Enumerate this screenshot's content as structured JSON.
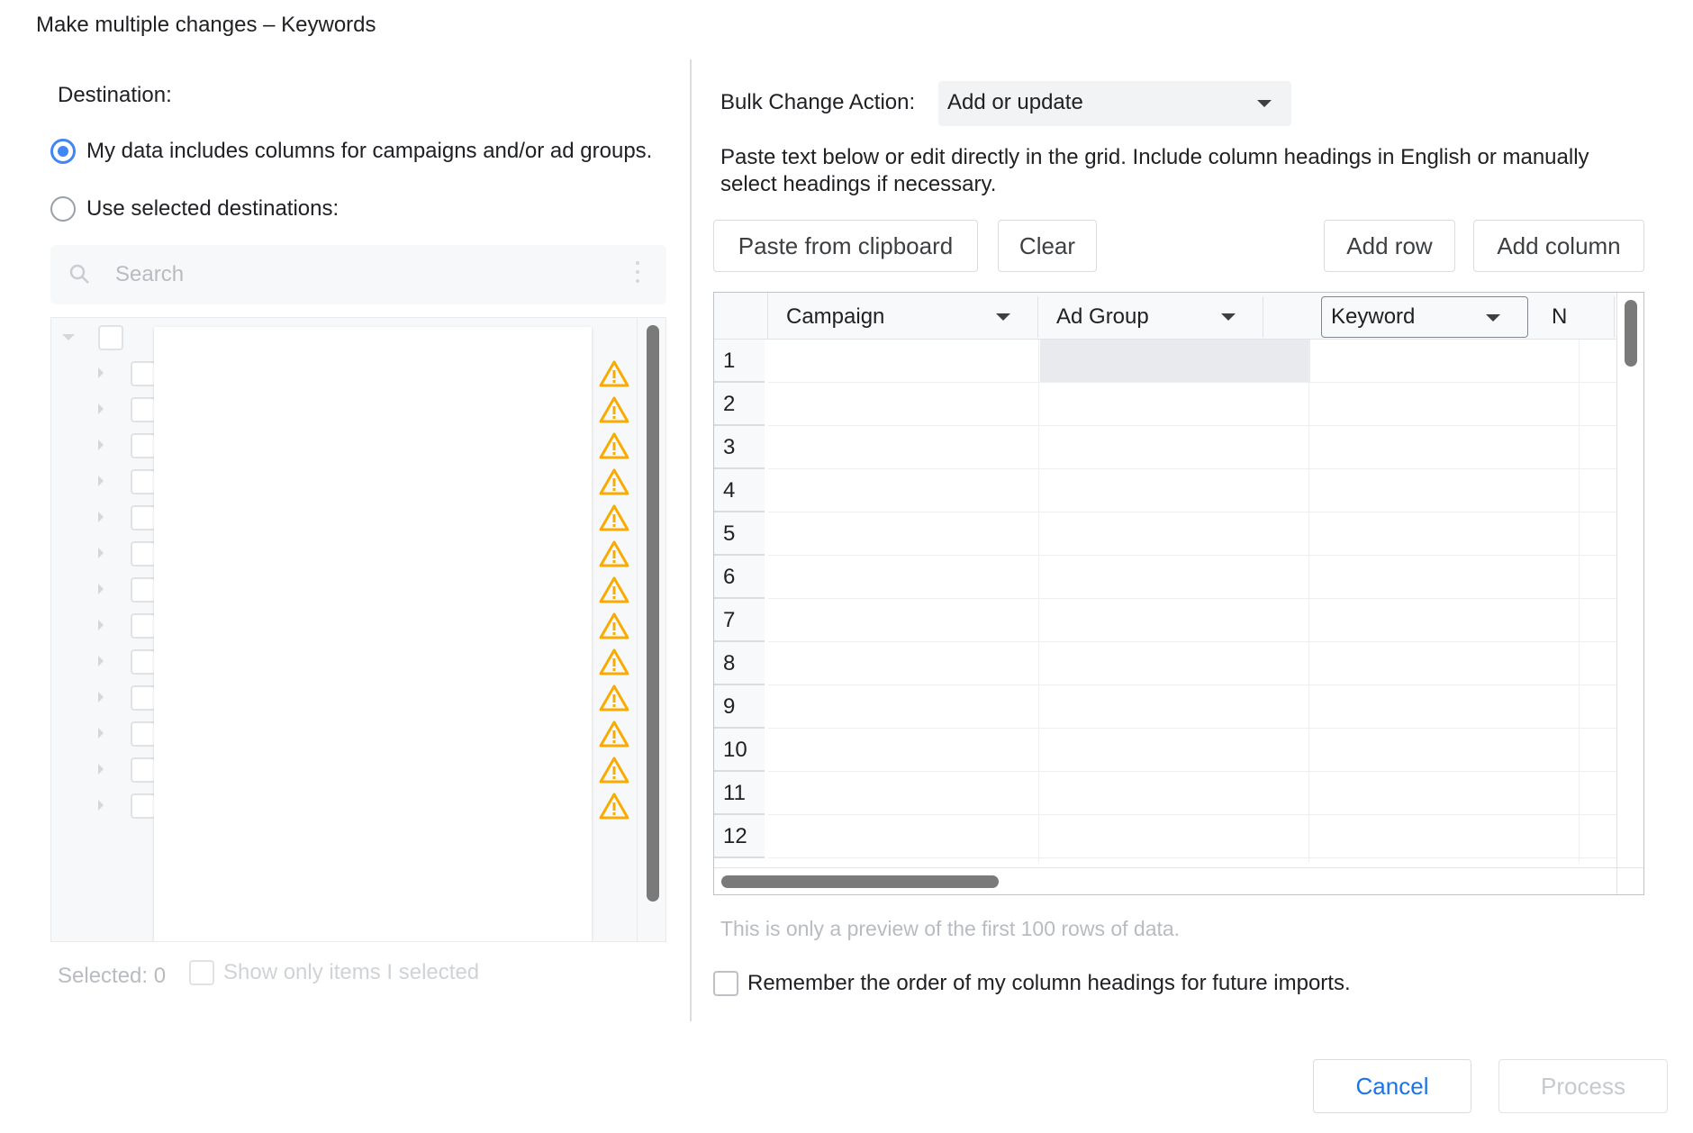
{
  "dialog": {
    "title": "Make multiple changes – Keywords"
  },
  "left": {
    "destination_label": "Destination:",
    "radio_options": [
      {
        "label": "My data includes columns for campaigns and/or ad groups.",
        "checked": true
      },
      {
        "label": "Use selected destinations:",
        "checked": false
      }
    ],
    "search": {
      "placeholder": "Search"
    },
    "tree_rows_count": 13,
    "selected_label": "Selected: 0",
    "show_only_label": "Show only items I selected"
  },
  "right": {
    "bulk_label": "Bulk Change Action:",
    "bulk_value": "Add or update",
    "instructions": "Paste text below or edit directly in the grid. Include column headings in English or manually select headings if necessary.",
    "buttons": {
      "paste": "Paste from clipboard",
      "clear": "Clear",
      "add_row": "Add row",
      "add_column": "Add column"
    },
    "grid": {
      "columns": [
        "Campaign",
        "Ad Group",
        "Keyword",
        "N"
      ],
      "rows": [
        "1",
        "2",
        "3",
        "4",
        "5",
        "6",
        "7",
        "8",
        "9",
        "10",
        "11",
        "12"
      ]
    },
    "preview_note": "This is only a preview of the first 100 rows of data.",
    "remember_label": "Remember the order of my column headings for future imports."
  },
  "footer": {
    "cancel": "Cancel",
    "process": "Process"
  },
  "colors": {
    "accent": "#1a73e8",
    "radio": "#4285f4",
    "warning": "#f9ab00"
  }
}
